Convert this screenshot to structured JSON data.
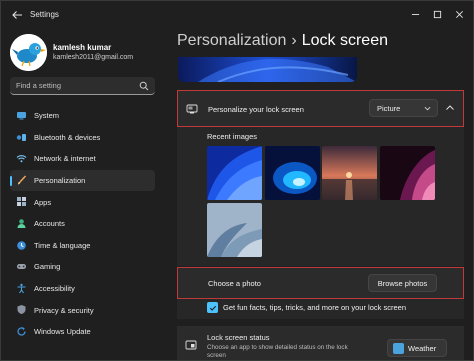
{
  "window": {
    "title": "Settings"
  },
  "profile": {
    "name": "kamlesh kumar",
    "email": "kamlesh2011@gmail.com"
  },
  "search": {
    "placeholder": "Find a setting"
  },
  "nav": {
    "items": [
      {
        "label": "System",
        "icon": "system-icon",
        "active": false
      },
      {
        "label": "Bluetooth & devices",
        "icon": "bluetooth-icon",
        "active": false
      },
      {
        "label": "Network & internet",
        "icon": "wifi-icon",
        "active": false
      },
      {
        "label": "Personalization",
        "icon": "brush-icon",
        "active": true
      },
      {
        "label": "Apps",
        "icon": "apps-icon",
        "active": false
      },
      {
        "label": "Accounts",
        "icon": "person-icon",
        "active": false
      },
      {
        "label": "Time & language",
        "icon": "globe-clock-icon",
        "active": false
      },
      {
        "label": "Gaming",
        "icon": "gamepad-icon",
        "active": false
      },
      {
        "label": "Accessibility",
        "icon": "accessibility-icon",
        "active": false
      },
      {
        "label": "Privacy & security",
        "icon": "shield-icon",
        "active": false
      },
      {
        "label": "Windows Update",
        "icon": "update-icon",
        "active": false
      }
    ]
  },
  "header": {
    "crumb": "Personalization",
    "separator": "›",
    "current": "Lock screen"
  },
  "lock_screen": {
    "label": "Personalize your lock screen",
    "dropdown_value": "Picture",
    "recent_label": "Recent images",
    "choose_label": "Choose a photo",
    "browse_label": "Browse photos",
    "fun_facts_label": "Get fun facts, tips, tricks, and more on your lock screen",
    "fun_facts_checked": true
  },
  "lock_status": {
    "title": "Lock screen status",
    "description": "Choose an app to show detailed status on the lock screen",
    "value": "Weather"
  },
  "colors": {
    "accent": "#4cc2ff",
    "highlight_border": "#c0393b",
    "background": "#1f1f1f",
    "card": "#2b2b2b"
  }
}
